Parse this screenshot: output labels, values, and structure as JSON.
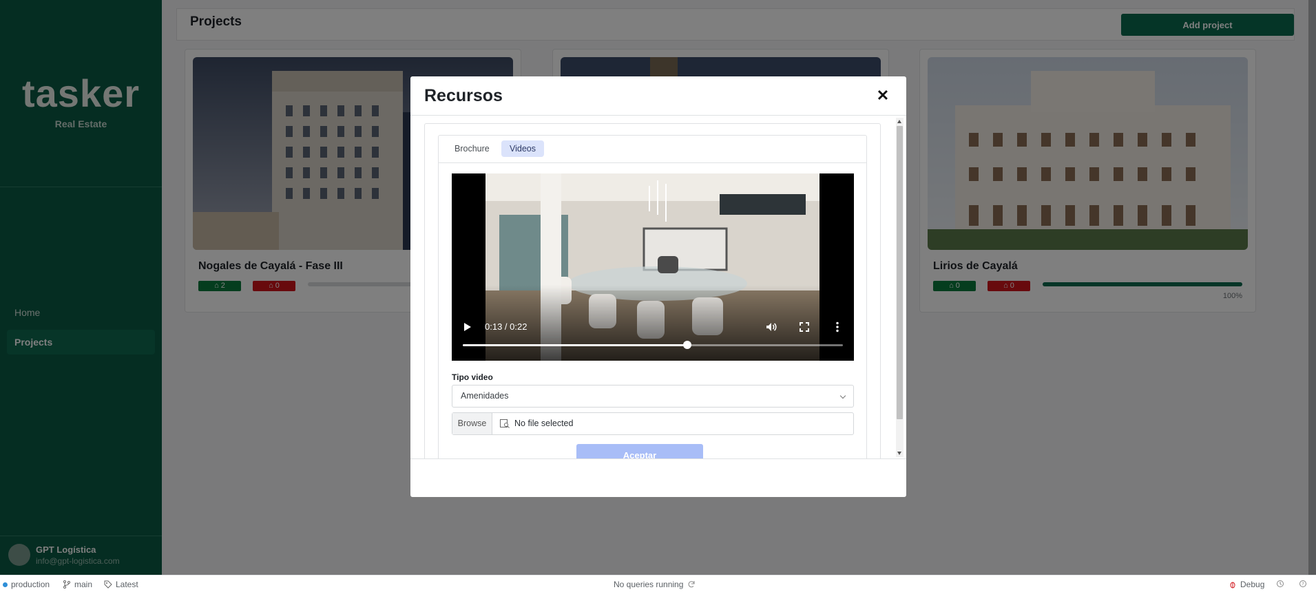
{
  "brand": {
    "name": "tasker",
    "subtitle": "Real Estate"
  },
  "sidebar": {
    "items": [
      {
        "label": "Home"
      },
      {
        "label": "Projects"
      }
    ],
    "user": {
      "name": "GPT Logística",
      "email": "info@gpt-logistica.com"
    }
  },
  "header": {
    "title": "Projects",
    "add_label": "Add project"
  },
  "projects": [
    {
      "title": "Nogales de Cayalá - Fase III",
      "badge_green": "2",
      "badge_red": "0"
    },
    {
      "title": "",
      "badge_green": "",
      "badge_red": ""
    },
    {
      "title": "Lirios de Cayalá",
      "badge_green": "0",
      "badge_red": "0",
      "progress_label": "100%",
      "progress": 1.0
    }
  ],
  "modal": {
    "title": "Recursos",
    "close_label": "✕",
    "tabs": [
      {
        "label": "Brochure"
      },
      {
        "label": "Videos"
      }
    ],
    "video": {
      "time": "0:13 / 0:22",
      "progress": 0.59
    },
    "field_label": "Tipo video",
    "select_value": "Amenidades",
    "browse_label": "Browse",
    "file_text": "No file selected",
    "accept_label": "Aceptar"
  },
  "statusbar": {
    "env": "production",
    "branch": "main",
    "tag": "Latest",
    "queries": "No queries running",
    "debug": "Debug"
  },
  "colors": {
    "sidebar": "#0b5a44",
    "accent": "#0b6a4f",
    "badge_red": "#d0141b",
    "badge_green": "#0b7a3d",
    "tab_active": "#dbe3fb",
    "accept": "#a8bdf7"
  }
}
